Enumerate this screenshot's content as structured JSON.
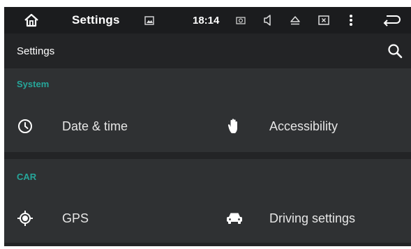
{
  "status_bar": {
    "home_icon": "home-outline-icon",
    "title": "Settings",
    "image_icon": "image-icon",
    "time": "18:14",
    "camera_icon": "camera-icon",
    "volume_icon": "volume-icon",
    "eject_icon": "eject-icon",
    "close_box_icon": "close-box-icon",
    "menu_icon": "more-vert-icon",
    "back_icon": "back-arrow-icon"
  },
  "action_bar": {
    "title": "Settings",
    "search_icon": "search-icon"
  },
  "sections": [
    {
      "header": "System",
      "items": [
        {
          "label": "Date & time",
          "icon": "clock-icon"
        },
        {
          "label": "Accessibility",
          "icon": "hand-icon"
        }
      ]
    },
    {
      "header": "CAR",
      "items": [
        {
          "label": "GPS",
          "icon": "gps-icon"
        },
        {
          "label": "Driving settings",
          "icon": "car-icon"
        }
      ]
    }
  ],
  "colors": {
    "accent": "#26a69a",
    "status_bar": "#1b1c1e",
    "action_bar": "#232426",
    "background": "#2f3133",
    "text": "#e6e6e6"
  }
}
